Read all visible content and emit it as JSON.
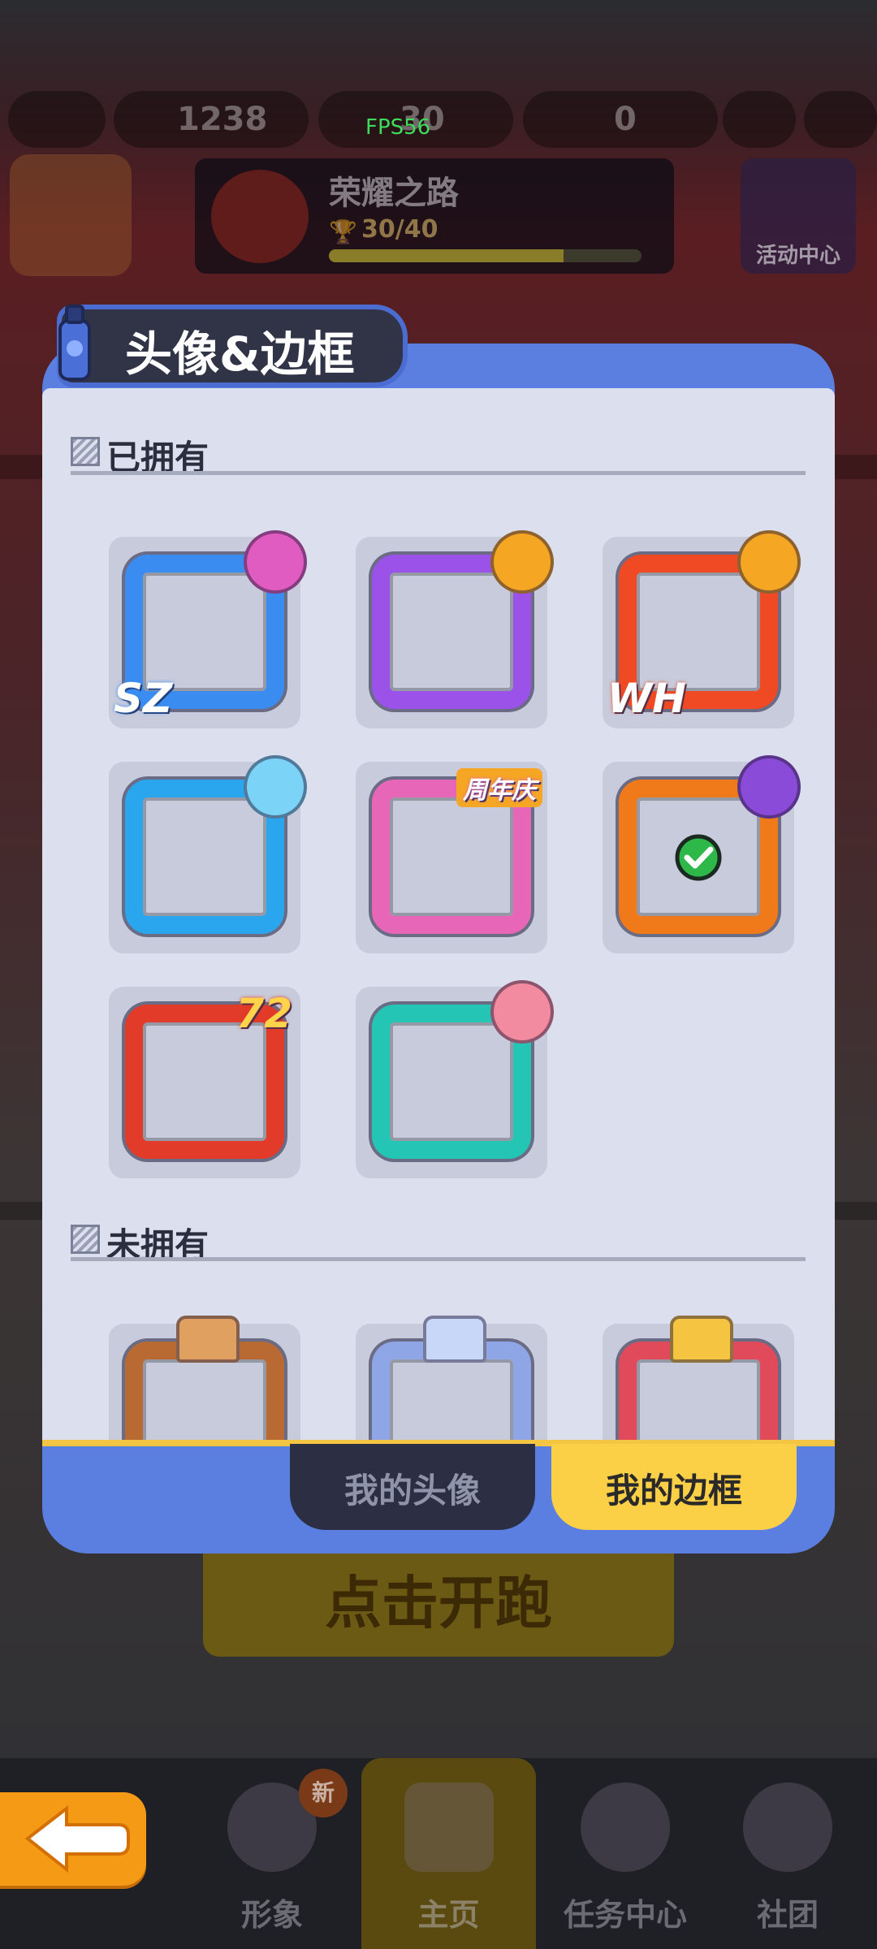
{
  "status": {
    "fps": "FPS56"
  },
  "background": {
    "currency": [
      {
        "name": "coin-icon",
        "value": "1238"
      },
      {
        "name": "key-icon",
        "value": "30"
      },
      {
        "name": "token-icon",
        "value": "0"
      }
    ],
    "glory": {
      "title": "荣耀之路",
      "progress": "30/40",
      "progress_fraction": 0.75
    },
    "activity_label": "活动中心",
    "start_label": "点击开跑",
    "nav": [
      {
        "label": "形象",
        "icon": "character-icon"
      },
      {
        "label": "主页",
        "icon": "home-board-icon"
      },
      {
        "label": "任务中心",
        "icon": "tasks-icon"
      },
      {
        "label": "社团",
        "icon": "club-icon"
      }
    ],
    "nav_badge": "新"
  },
  "modal": {
    "title": "头像&边框",
    "owned": {
      "heading": "已拥有",
      "frames": [
        {
          "name": "sz-blue-frame",
          "color": "#3a8cf0",
          "accent": "#e05cc0",
          "label": "SZ",
          "selected": false
        },
        {
          "name": "music-halloween-frame",
          "color": "#9a52e8",
          "accent": "#f5a623",
          "label": "",
          "selected": false
        },
        {
          "name": "wh-pagoda-frame",
          "color": "#ef4a24",
          "accent": "#f5a623",
          "label": "WH",
          "selected": false
        },
        {
          "name": "whale-ice-frame",
          "color": "#2aa6ee",
          "accent": "#7bd4f7",
          "label": "",
          "selected": false
        },
        {
          "name": "anniversary-frame",
          "color": "#e866b8",
          "accent": "#f5a623",
          "label": "周年庆",
          "selected": false
        },
        {
          "name": "ghost-halloween-frame",
          "color": "#f07a1a",
          "accent": "#8a4bd8",
          "label": "",
          "selected": true
        },
        {
          "name": "seventy-two-frame",
          "color": "#e23b2a",
          "accent": "#f5a623",
          "label": "72",
          "selected": false
        },
        {
          "name": "alarm-clock-frame",
          "color": "#24c5b4",
          "accent": "#f28aa0",
          "label": "",
          "selected": false
        }
      ]
    },
    "unowned": {
      "heading": "未拥有",
      "frames": [
        {
          "name": "bronze-crown-frame",
          "color": "#b86a32",
          "accent": "#e0a060"
        },
        {
          "name": "silver-crown-frame",
          "color": "#8ea6e6",
          "accent": "#c8d6f8"
        },
        {
          "name": "gold-crown-frame",
          "color": "#e04a5a",
          "accent": "#f5c542"
        }
      ]
    },
    "tabs": [
      {
        "label": "我的头像",
        "active": false
      },
      {
        "label": "我的边框",
        "active": true
      }
    ]
  }
}
